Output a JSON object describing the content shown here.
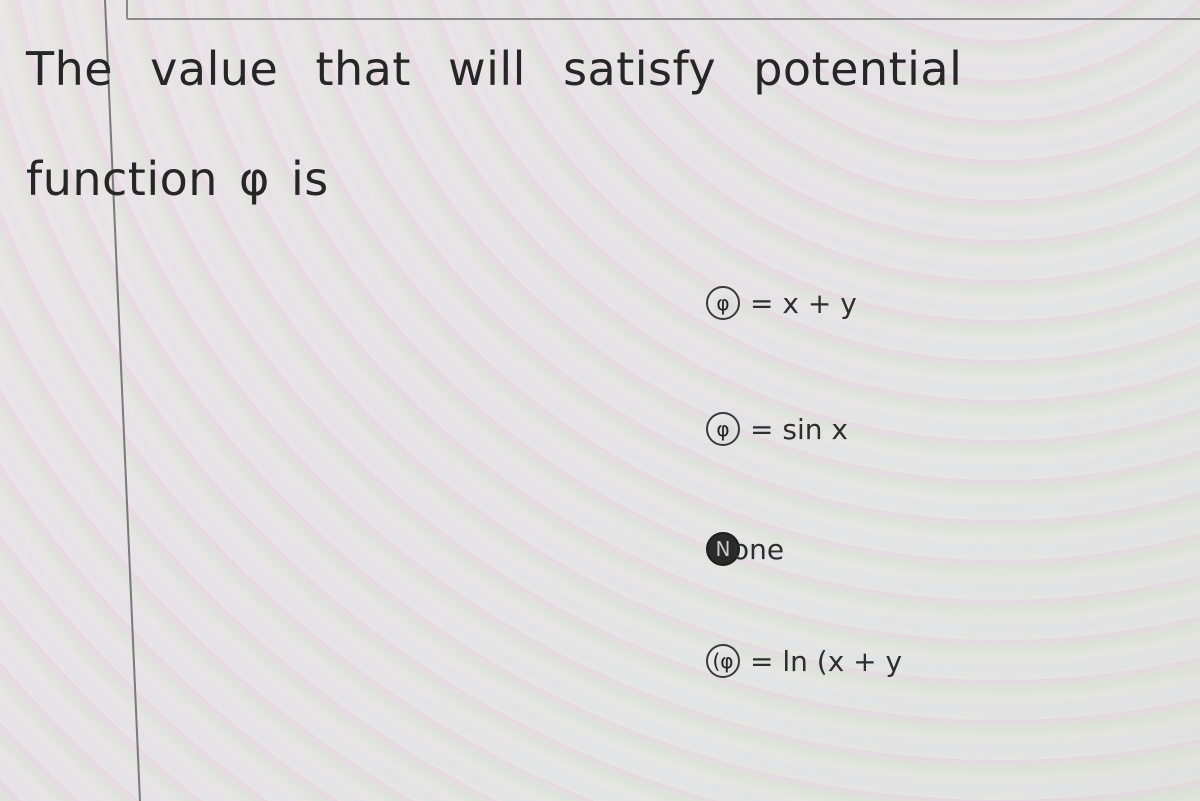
{
  "question": {
    "line1": "The value that will satisfy potential",
    "line2": "function φ is"
  },
  "options": [
    {
      "radio_glyph": "φ",
      "label": "= x + y",
      "selected": false
    },
    {
      "radio_glyph": "φ",
      "label": "= sin x",
      "selected": false
    },
    {
      "radio_glyph": "N",
      "label": "one",
      "selected": true
    },
    {
      "radio_glyph": "(φ",
      "label": "= ln (x + y",
      "selected": false
    }
  ],
  "colors": {
    "text": "#2a2a2a",
    "selected_radio": "#2a2a2a"
  }
}
